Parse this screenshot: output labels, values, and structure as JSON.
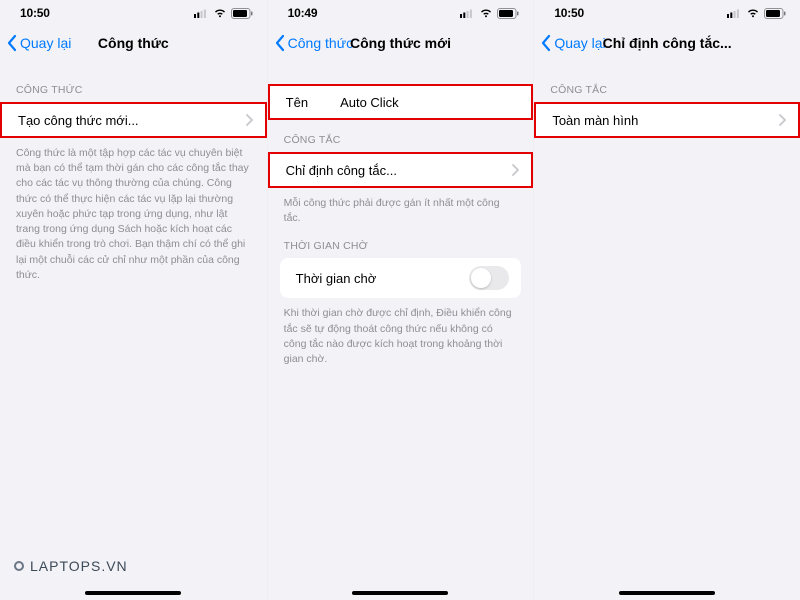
{
  "colors": {
    "accent": "#007aff",
    "highlight_border": "#e20000"
  },
  "watermark_text": "LAPTOPS.VN",
  "screens": [
    {
      "time": "10:50",
      "back_label": "Quay lại",
      "title": "Công thức",
      "section1_header": "CÔNG THỨC",
      "row1_label": "Tạo công thức mới...",
      "desc": "Công thức là một tập hợp các tác vụ chuyên biệt mà bạn có thể tạm thời gán cho các công tắc thay cho các tác vụ thông thường của chúng. Công thức có thể thực hiện các tác vụ lặp lại thường xuyên hoặc phức tạp trong ứng dụng, như lật trang trong ứng dụng Sách hoặc kích hoạt các điều khiển trong trò chơi. Bạn thậm chí có thể ghi lại một chuỗi các cử chỉ như một phần của công thức."
    },
    {
      "time": "10:49",
      "back_label": "Công thức",
      "title": "Công thức mới",
      "name_label": "Tên",
      "name_value": "Auto Click",
      "section2_header": "CÔNG TẮC",
      "row2_label": "Chỉ định công tắc...",
      "row2_desc": "Mỗi công thức phải được gán ít nhất một công tắc.",
      "section3_header": "THỜI GIAN CHỜ",
      "row3_label": "Thời gian chờ",
      "row3_desc": "Khi thời gian chờ được chỉ định, Điều khiển công tắc sẽ tự động thoát công thức nếu không có công tắc nào được kích hoạt trong khoảng thời gian chờ."
    },
    {
      "time": "10:50",
      "back_label": "Quay lại",
      "title": "Chỉ định công tắc...",
      "section1_header": "CÔNG TẮC",
      "row1_label": "Toàn màn hình"
    }
  ]
}
